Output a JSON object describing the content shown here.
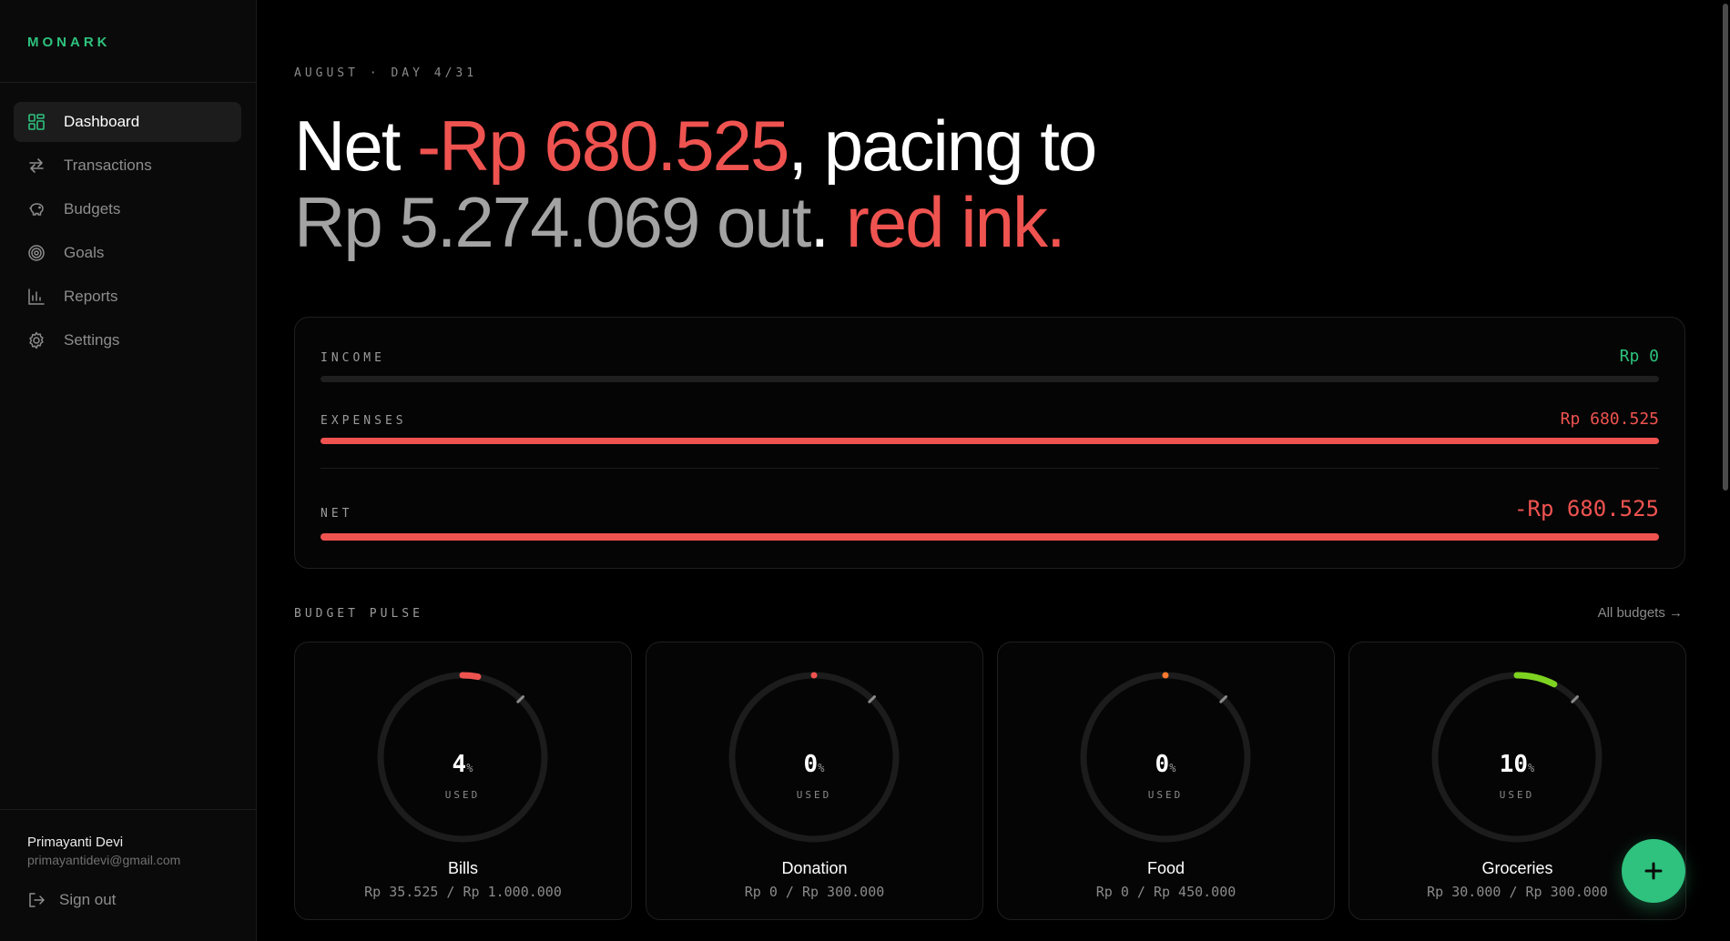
{
  "sidebar": {
    "brand": "MONARK",
    "items": [
      {
        "label": "Dashboard",
        "icon": "dashboard-icon",
        "active": true
      },
      {
        "label": "Transactions",
        "icon": "transactions-icon"
      },
      {
        "label": "Budgets",
        "icon": "piggy-bank-icon"
      },
      {
        "label": "Goals",
        "icon": "target-icon"
      },
      {
        "label": "Reports",
        "icon": "bar-chart-icon"
      },
      {
        "label": "Settings",
        "icon": "gear-icon"
      }
    ],
    "user": {
      "name": "Primayanti Devi",
      "email": "primayantidevi@gmail.com"
    },
    "signout_label": "Sign out"
  },
  "header": {
    "eyebrow": "AUGUST · DAY 4/31",
    "headline": {
      "part1": "Net ",
      "net_amount": "-Rp 680.525",
      "part2": ", pacing to",
      "pacing_amount": "Rp 5.274.069 out",
      "part3": ". ",
      "verdict": "red ink."
    }
  },
  "summary": {
    "income": {
      "label": "INCOME",
      "value": "Rp 0",
      "fraction": 0
    },
    "expenses": {
      "label": "EXPENSES",
      "value": "Rp 680.525",
      "fraction": 1
    },
    "net": {
      "label": "NET",
      "value": "-Rp 680.525",
      "fraction": 1
    }
  },
  "budget_pulse": {
    "title": "BUDGET PULSE",
    "all_link": "All budgets →",
    "used_label": "USED",
    "percent_unit": "%",
    "cards": [
      {
        "name": "Bills",
        "percent": 4,
        "amount": "Rp 35.525 / Rp 1.000.000",
        "color": "#ef5350"
      },
      {
        "name": "Donation",
        "percent": 0,
        "amount": "Rp 0 / Rp 300.000",
        "color": "#ef5350"
      },
      {
        "name": "Food",
        "percent": 0,
        "amount": "Rp 0 / Rp 450.000",
        "color": "#ff7a2f"
      },
      {
        "name": "Groceries",
        "percent": 10,
        "amount": "Rp 30.000 / Rp 300.000",
        "color": "#7ed321"
      }
    ]
  },
  "colors": {
    "accent": "#2ec27e",
    "negative": "#ef5350",
    "positive": "#2ec27e"
  }
}
